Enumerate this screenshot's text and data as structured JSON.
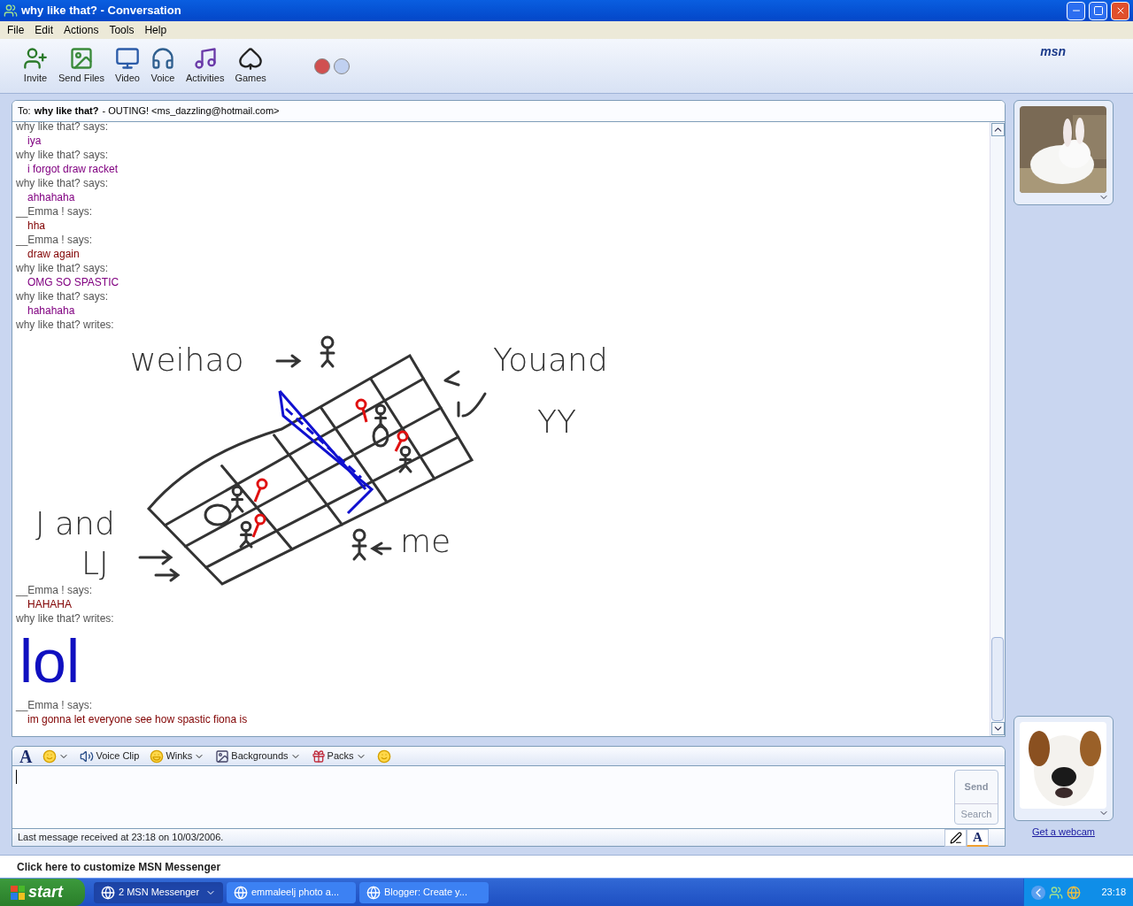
{
  "window": {
    "title": "why like that? - Conversation"
  },
  "menu": [
    "File",
    "Edit",
    "Actions",
    "Tools",
    "Help"
  ],
  "toolbar": [
    {
      "kind": "invite",
      "label": "Invite"
    },
    {
      "kind": "files",
      "label": "Send Files"
    },
    {
      "kind": "video",
      "label": "Video"
    },
    {
      "kind": "voice",
      "label": "Voice"
    },
    {
      "kind": "activities",
      "label": "Activities"
    },
    {
      "kind": "games",
      "label": "Games"
    }
  ],
  "brand": "msn",
  "to": {
    "label": "To:",
    "name": "why like that?",
    "detail": "- OUTING! <ms_dazzling@hotmail.com>"
  },
  "messages": [
    {
      "kind": "text",
      "sender": "why like that? says:",
      "text": "iya",
      "color": "#800080"
    },
    {
      "kind": "text",
      "sender": "why like that? says:",
      "text": "i forgot draw racket",
      "color": "#800080"
    },
    {
      "kind": "text",
      "sender": "why like that? says:",
      "text": "ahhahaha",
      "color": "#800080"
    },
    {
      "kind": "text",
      "sender": "__Emma ! says:",
      "text": "hha",
      "color": "#800000"
    },
    {
      "kind": "text",
      "sender": "__Emma ! says:",
      "text": "draw again",
      "color": "#800000"
    },
    {
      "kind": "text",
      "sender": "why like that? says:",
      "text": "OMG SO SPASTIC",
      "color": "#800080"
    },
    {
      "kind": "text",
      "sender": "why like that? says:",
      "text": "hahahaha",
      "color": "#800080"
    },
    {
      "kind": "sketch",
      "sender": "why like that? writes:",
      "words": [
        "weihao",
        "Youand",
        "YY",
        "J and",
        "LJ",
        "me"
      ]
    },
    {
      "kind": "text",
      "sender": "__Emma ! says:",
      "text": "HAHAHA",
      "color": "#800000"
    },
    {
      "kind": "handwriting",
      "sender": "why like that? writes:",
      "words": [
        "lol"
      ]
    },
    {
      "kind": "text",
      "sender": "__Emma ! says:",
      "text": "im gonna let everyone see how spastic fiona is",
      "color": "#800000"
    }
  ],
  "compose_tools": [
    {
      "kind": "font",
      "label": "A",
      "dropdown": false
    },
    {
      "kind": "emoticon",
      "dropdown": true
    },
    {
      "kind": "voice",
      "label": "Voice Clip",
      "dropdown": false
    },
    {
      "kind": "wink",
      "label": "Winks",
      "dropdown": true
    },
    {
      "kind": "background",
      "label": "Backgrounds",
      "dropdown": true
    },
    {
      "kind": "pack",
      "label": "Packs",
      "dropdown": true
    },
    {
      "kind": "nudge",
      "dropdown": false
    }
  ],
  "send": "Send",
  "search": "Search",
  "status": "Last message received at 23:18 on 10/03/2006.",
  "mode_tabs": [
    {
      "kind": "handwriting",
      "selected": false
    },
    {
      "kind": "type",
      "label": "A",
      "selected": true
    }
  ],
  "webcam_link": "Get a webcam",
  "customize": "Click here to customize MSN Messenger",
  "taskbar": {
    "start": "start",
    "tasks": [
      {
        "label": "2 MSN Messenger",
        "selected": true,
        "dropdown": true
      },
      {
        "label": "emmaleelj photo a...",
        "selected": false,
        "dropdown": false
      },
      {
        "label": "Blogger: Create y...",
        "selected": false,
        "dropdown": false
      }
    ],
    "clock": "23:18"
  }
}
